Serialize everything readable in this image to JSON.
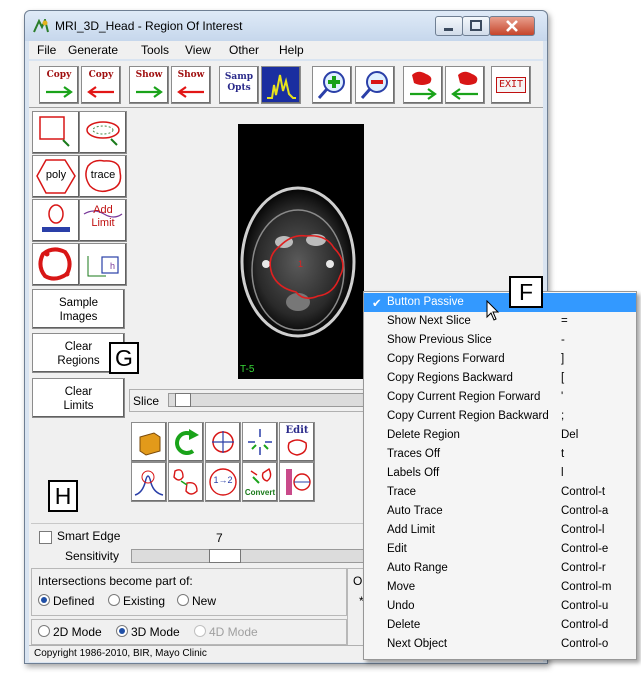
{
  "window": {
    "title": "MRI_3D_Head - Region Of Interest"
  },
  "menubar": [
    "File",
    "Generate",
    "Tools",
    "View",
    "Other",
    "Help"
  ],
  "toolbar": {
    "copy_forward": [
      "Copy"
    ],
    "copy_backward": [
      "Copy"
    ],
    "show_forward": [
      "Show"
    ],
    "show_backward": [
      "Show"
    ],
    "samp_opts": [
      "Samp",
      "Opts"
    ],
    "exit": "EXIT"
  },
  "left_panel": {
    "poly": "poly",
    "trace": "trace",
    "add_limit": [
      "Add",
      "Limit"
    ],
    "sample_images": [
      "Sample",
      "Images"
    ],
    "clear_regions": [
      "Clear",
      "Regions"
    ],
    "clear_limits": [
      "Clear",
      "Limits"
    ]
  },
  "image": {
    "slice_label": "T-5"
  },
  "slice": {
    "label": "Slice",
    "value_fraction": 0.03
  },
  "icon_buttons": {
    "edit": "Edit",
    "convert": "Convert",
    "one_to_two": "1→2"
  },
  "smart_edge": {
    "label": "Smart Edge",
    "value": "7",
    "sensitivity_label": "Sensitivity",
    "sensitivity_fraction": 0.35
  },
  "intersections": {
    "label": "Intersections become part of:",
    "options": [
      "Defined",
      "Existing",
      "New"
    ],
    "selected": "Defined",
    "partial_heading": "O",
    "partial_value": "*"
  },
  "modes": {
    "options": [
      "2D Mode",
      "3D Mode",
      "4D Mode"
    ],
    "selected": "3D Mode"
  },
  "status": "Copyright 1986-2010, BIR, Mayo Clinic",
  "callouts": {
    "f": "F",
    "g": "G",
    "h": "H"
  },
  "context_menu": {
    "items": [
      {
        "label": "Button Passive",
        "shortcut": "",
        "checked": true
      },
      {
        "label": "Show Next Slice",
        "shortcut": "="
      },
      {
        "label": "Show Previous Slice",
        "shortcut": "-"
      },
      {
        "label": "Copy Regions Forward",
        "shortcut": "]"
      },
      {
        "label": "Copy Regions Backward",
        "shortcut": "["
      },
      {
        "label": "Copy Current Region Forward",
        "shortcut": "'"
      },
      {
        "label": "Copy Current Region Backward",
        "shortcut": ";"
      },
      {
        "label": "Delete Region",
        "shortcut": "Del"
      },
      {
        "label": "Traces Off",
        "shortcut": "t"
      },
      {
        "label": "Labels Off",
        "shortcut": "l"
      },
      {
        "label": "Trace",
        "shortcut": "Control-t"
      },
      {
        "label": "Auto Trace",
        "shortcut": "Control-a"
      },
      {
        "label": "Add Limit",
        "shortcut": "Control-l"
      },
      {
        "label": "Edit",
        "shortcut": "Control-e"
      },
      {
        "label": "Auto Range",
        "shortcut": "Control-r"
      },
      {
        "label": "Move",
        "shortcut": "Control-m"
      },
      {
        "label": "Undo",
        "shortcut": "Control-u"
      },
      {
        "label": "Delete",
        "shortcut": "Control-d"
      },
      {
        "label": "Next Object",
        "shortcut": "Control-o"
      }
    ],
    "check_mark": "✔"
  },
  "colors": {
    "selection": "#3399ff",
    "title_bar": "#c6d7ec",
    "region_trace": "#e02020",
    "arrow_green": "#1aa31a",
    "arrow_red": "#e21616"
  }
}
